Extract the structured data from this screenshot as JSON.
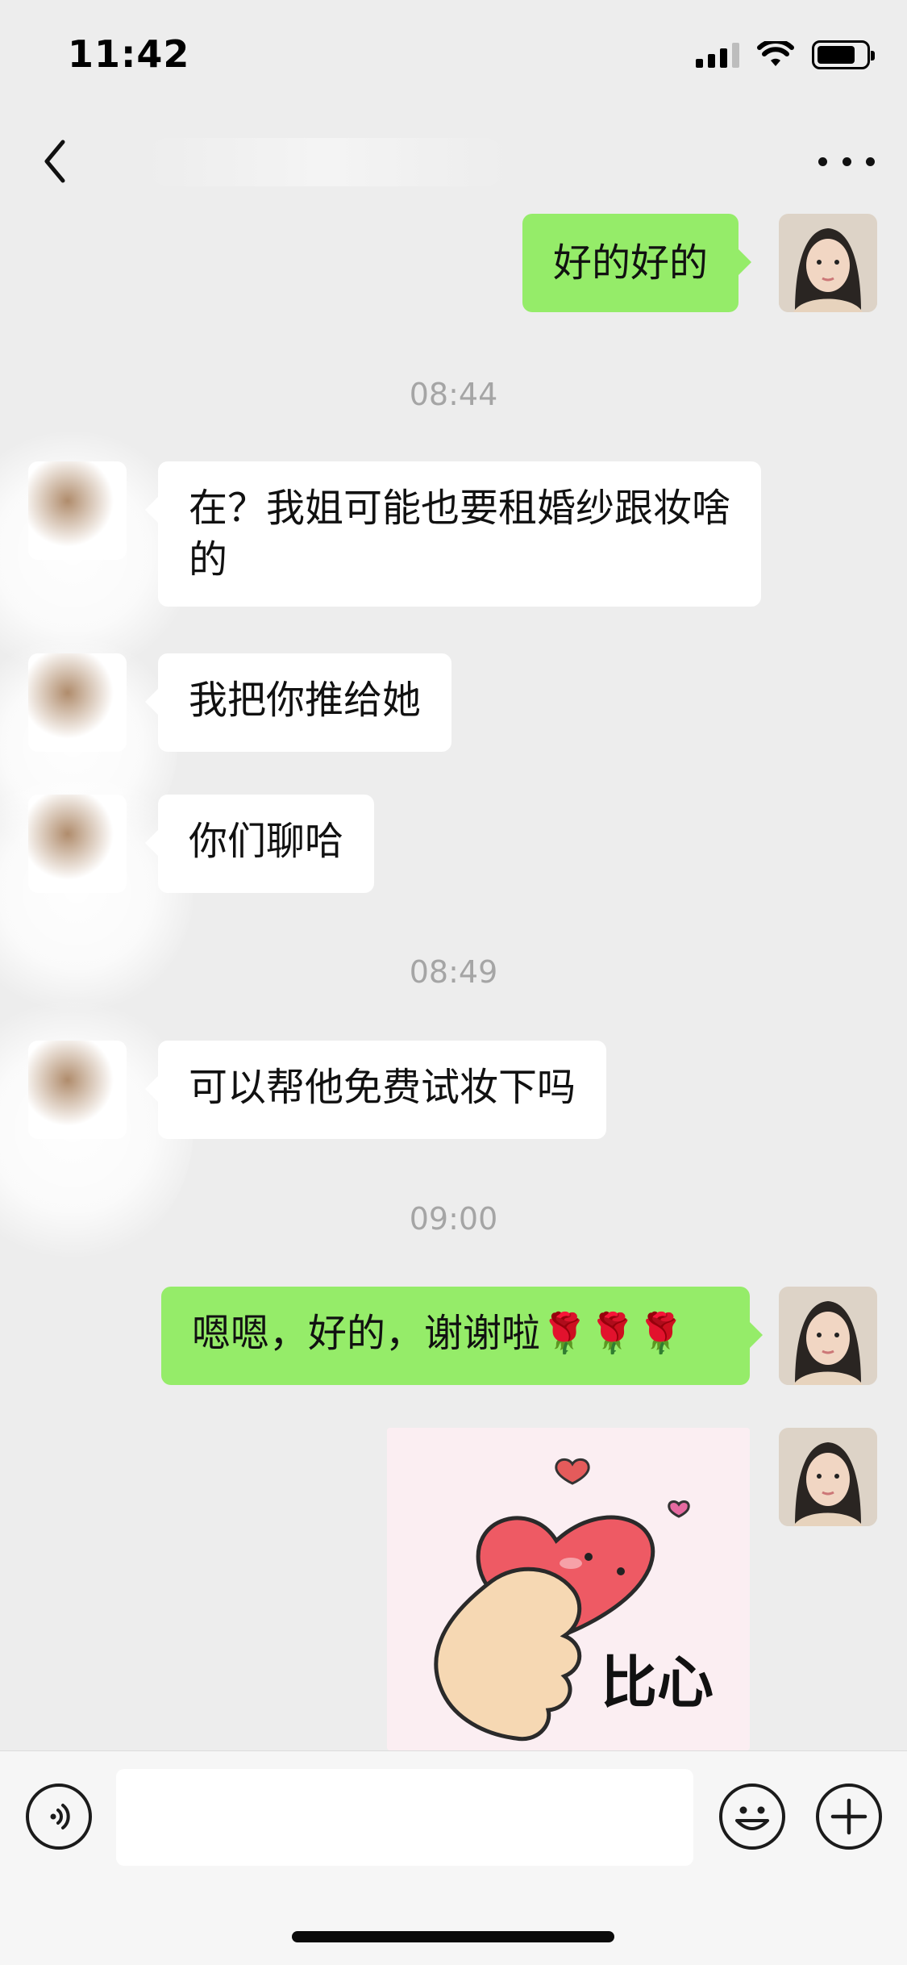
{
  "status_bar": {
    "time": "11:42",
    "battery_level": 0.8
  },
  "nav": {
    "title": "",
    "back_icon": "chevron-left-icon",
    "more_icon": "more-dots-icon"
  },
  "colors": {
    "background": "#ededed",
    "incoming_bubble": "#ffffff",
    "outgoing_bubble": "#95ec69",
    "timestamp": "#a5a5a5"
  },
  "messages": [
    {
      "id": "m1",
      "direction": "out",
      "text": "好的好的"
    },
    {
      "id": "t1",
      "type": "timestamp",
      "text": "08:44"
    },
    {
      "id": "m2",
      "direction": "in",
      "text": "在？我姐可能也要租婚纱跟妆啥的"
    },
    {
      "id": "m3",
      "direction": "in",
      "text": "我把你推给她"
    },
    {
      "id": "m4",
      "direction": "in",
      "text": "你们聊哈"
    },
    {
      "id": "t2",
      "type": "timestamp",
      "text": "08:49"
    },
    {
      "id": "m5",
      "direction": "in",
      "text": "可以帮他免费试妆下吗"
    },
    {
      "id": "t3",
      "type": "timestamp",
      "text": "09:00"
    },
    {
      "id": "m6",
      "direction": "out",
      "text": "嗯嗯，好的，谢谢啦🌹🌹🌹"
    },
    {
      "id": "m7",
      "direction": "out",
      "type": "sticker",
      "sticker_text": "比心"
    }
  ],
  "input_bar": {
    "placeholder": "",
    "voice_icon": "voice-icon",
    "emoji_icon": "emoji-icon",
    "plus_icon": "plus-icon"
  }
}
